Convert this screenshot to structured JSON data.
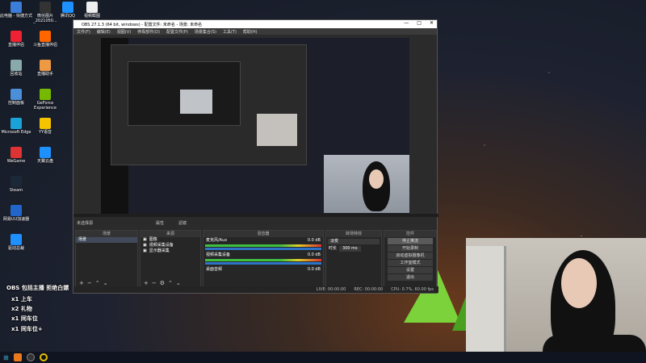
{
  "desktop": {
    "icons": [
      {
        "label": "此电脑 - 快捷方式",
        "color": "#3b7dd8"
      },
      {
        "label": "微信图片_2021050...",
        "color": "#333"
      },
      {
        "label": "腾讯QQ",
        "color": "#1e90ff"
      },
      {
        "label": "视频截图",
        "color": "#eee"
      },
      {
        "label": "直播伴侣",
        "color": "#e23"
      },
      {
        "label": "斗鱼直播伴侣",
        "color": "#f60"
      },
      {
        "label": "回收站",
        "color": "#8aa"
      },
      {
        "label": "直播助手",
        "color": "#e94"
      },
      {
        "label": "控制面板",
        "color": "#4a8fd8"
      },
      {
        "label": "GeForce Experience",
        "color": "#76b900"
      },
      {
        "label": "Microsoft Edge",
        "color": "#1aa3d9"
      },
      {
        "label": "YY语音",
        "color": "#f5c400"
      },
      {
        "label": "WeGame",
        "color": "#d33"
      },
      {
        "label": "天翼云盘",
        "color": "#1e90ff"
      },
      {
        "label": "Steam",
        "color": "#1b2838"
      },
      {
        "label": "网易UU加速器",
        "color": "#2266cc"
      },
      {
        "label": "驱动总裁",
        "color": "#1e90ff"
      }
    ]
  },
  "obs": {
    "title": "OBS 27.1.3 (64 bit, windows) - 配置文件: 未命名 - 场景: 未命名",
    "menu": [
      "文件(F)",
      "编辑(E)",
      "视图(V)",
      "停靠部件(D)",
      "配置文件(P)",
      "场景集合(S)",
      "工具(T)",
      "帮助(H)"
    ],
    "source_bar": {
      "label": "未选择源",
      "props": "属性",
      "filters": "滤镜"
    },
    "docks": {
      "scenes": {
        "title": "场景",
        "items": [
          "场景"
        ]
      },
      "sources": {
        "title": "来源",
        "items": [
          "图像",
          "视频采集设备",
          "显示器采集"
        ]
      },
      "mixer": {
        "title": "混音器",
        "channels": [
          {
            "name": "麦克风/Aux",
            "db": "0.0 dB"
          },
          {
            "name": "视频采集设备",
            "db": "0.0 dB"
          },
          {
            "name": "桌面音频",
            "db": "0.0 dB"
          }
        ]
      },
      "transitions": {
        "title": "转场特效",
        "type": "淡变",
        "duration_label": "时长",
        "duration": "300 ms"
      },
      "controls": {
        "title": "控件",
        "buttons": [
          "停止推流",
          "开始录制",
          "启动虚拟摄像机",
          "工作室模式",
          "设置",
          "退出"
        ]
      }
    },
    "status": {
      "live": "LIVE: 00:00:00",
      "rec": "REC: 00:00:00",
      "cpu": "CPU: 0.7%, 60.00 fps"
    }
  },
  "overlay": {
    "lines": [
      "OBS 包括主播  拒绝白嫖",
      "x1 上车",
      "x2 礼物",
      "x1 同车位",
      "x1 同车位+"
    ]
  },
  "icons": {
    "minimize": "minimize-icon",
    "maximize": "maximize-icon",
    "close": "close-icon"
  }
}
